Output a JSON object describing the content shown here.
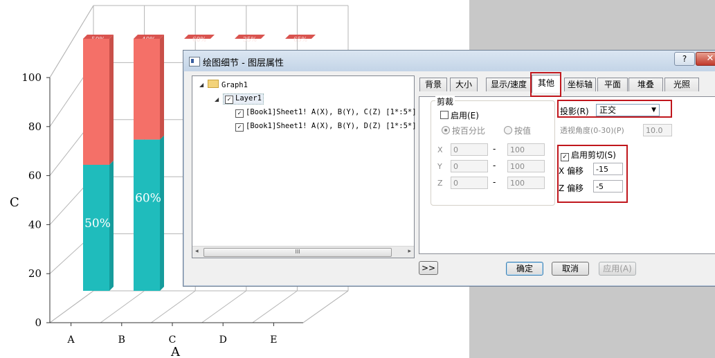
{
  "chart_data": {
    "type": "bar",
    "categories": [
      "A",
      "B",
      "C",
      "D",
      "E"
    ],
    "series": [
      {
        "values": [
          50,
          60,
          0,
          0,
          0
        ],
        "color": "#1fbcbc"
      },
      {
        "values": [
          50,
          40,
          0,
          0,
          0
        ],
        "color": "#f47068"
      }
    ],
    "top_labels": [
      "50%",
      "40%",
      "60%",
      "35%",
      "65%"
    ],
    "seg_labels": [
      "50%",
      "60%"
    ],
    "xlabel": "A",
    "ylabel": "C",
    "yticks": [
      "0",
      "20",
      "40",
      "60",
      "80",
      "100"
    ],
    "ylim": [
      0,
      100
    ],
    "grid": true
  },
  "dialog": {
    "title": "绘图细节 - 图层属性",
    "help": "?",
    "close": "✕",
    "tree": {
      "root": "Graph1",
      "layer": "Layer1",
      "items": [
        "[Book1]Sheet1! A(X), B(Y), C(Z) [1*:5*]",
        "[Book1]Sheet1! A(X), B(Y), D(Z) [1*:5*]"
      ],
      "scroll_grip": "III",
      "left_arrow": "◂",
      "right_arrow": "▸"
    },
    "tabs": [
      "背景",
      "大小",
      "显示/速度",
      "其他",
      "坐标轴",
      "平面",
      "堆叠",
      "光照"
    ],
    "clip": {
      "group_label": "剪裁",
      "enable_label": "启用(E)",
      "by_percent_label": "按百分比",
      "by_value_label": "按值",
      "rows": [
        {
          "axis": "X",
          "from": "0",
          "dash": "-",
          "to": "100"
        },
        {
          "axis": "Y",
          "from": "0",
          "dash": "-",
          "to": "100"
        },
        {
          "axis": "Z",
          "from": "0",
          "dash": "-",
          "to": "100"
        }
      ]
    },
    "projection": {
      "label": "投影(R)",
      "value": "正交",
      "perspective_label": "透视角度(0-30)(P)",
      "perspective_value": "10.0"
    },
    "shear": {
      "enable_label": "启用剪切(S)",
      "x_label": "X 偏移",
      "x_value": "-15",
      "z_label": "Z 偏移",
      "z_value": "-5"
    },
    "buttons": {
      "expand": ">>",
      "ok": "确定",
      "cancel": "取消",
      "apply": "应用(A)"
    }
  }
}
